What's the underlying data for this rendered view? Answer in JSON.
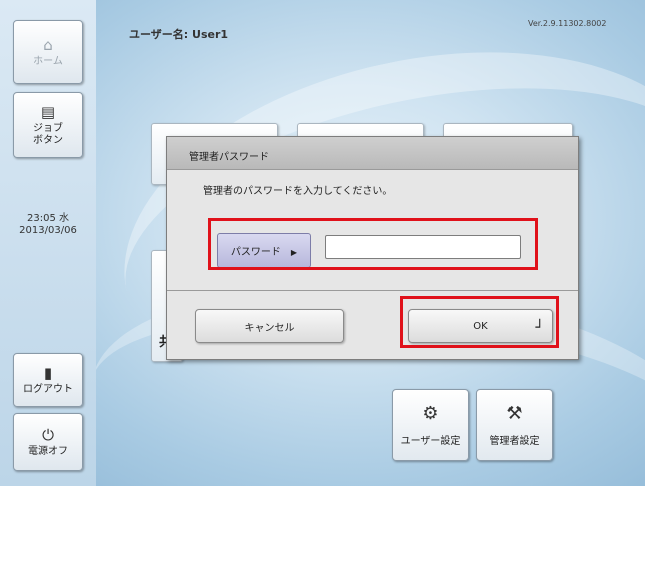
{
  "header": {
    "username": "ユーザー名: User1",
    "version": "Ver.2.9.11302.8002"
  },
  "sidebar": {
    "home": {
      "label": "ホーム",
      "icon": "home-icon"
    },
    "job": {
      "label": "ジョブ\nボタン",
      "icon": "job-icon"
    },
    "clock": {
      "time": "23:05 水",
      "date": "2013/03/06"
    },
    "logout": {
      "label": "ログアウト",
      "icon": "logout-icon"
    },
    "power": {
      "label": "電源オフ",
      "icon": "power-icon"
    }
  },
  "bottom": {
    "user_settings": {
      "label": "ユーザー設定",
      "icon": "user-settings-icon"
    },
    "admin_settings": {
      "label": "管理者設定",
      "icon": "admin-settings-icon"
    }
  },
  "background_tiles": {
    "partial_label": "共"
  },
  "dialog": {
    "title": "管理者パスワード",
    "message": "管理者のパスワードを入力してください。",
    "password_label": "パスワード",
    "password_value": "",
    "cancel_label": "キャンセル",
    "ok_label": "OK"
  },
  "highlight_color": "#e0111a"
}
